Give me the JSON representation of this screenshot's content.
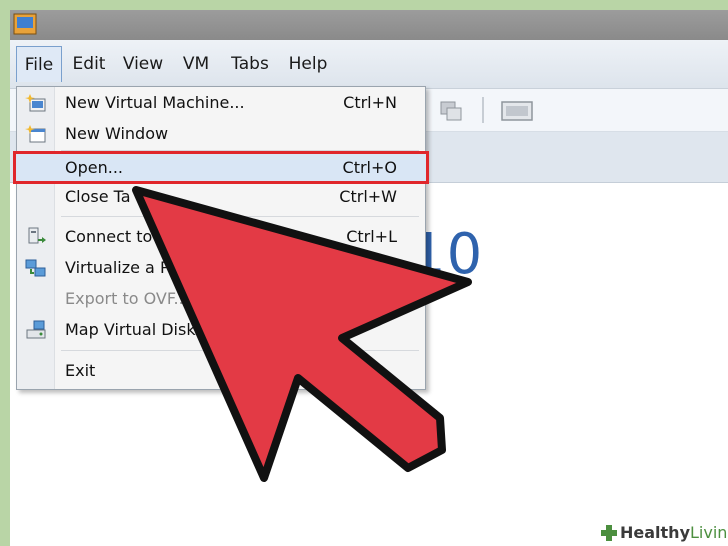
{
  "menubar": {
    "items": [
      {
        "label": "File",
        "active": true
      },
      {
        "label": "Edit"
      },
      {
        "label": "View"
      },
      {
        "label": "VM"
      },
      {
        "label": "Tabs"
      },
      {
        "label": "Help"
      }
    ]
  },
  "content": {
    "number_fragment": "10"
  },
  "file_menu": {
    "items": [
      {
        "label": "New Virtual Machine...",
        "shortcut": "Ctrl+N",
        "icon": "new-vm-icon"
      },
      {
        "label": "New Window",
        "shortcut": "",
        "icon": "new-window-icon"
      },
      {
        "label": "Open...",
        "shortcut": "Ctrl+O",
        "highlighted": true
      },
      {
        "label": "Close Ta",
        "shortcut": "Ctrl+W"
      },
      {
        "label": "Connect to",
        "shortcut": "Ctrl+L",
        "icon": "connect-icon"
      },
      {
        "label": "Virtualize a P",
        "shortcut": "",
        "icon": "virtualize-icon"
      },
      {
        "label": "Export to OVF...",
        "shortcut": "",
        "disabled": true
      },
      {
        "label": "Map Virtual Disks",
        "shortcut": "",
        "icon": "map-disks-icon"
      },
      {
        "label": "Exit",
        "shortcut": ""
      }
    ]
  },
  "watermark": {
    "part1": "Healthy",
    "part2": "Living"
  },
  "colors": {
    "highlight_border": "#e0262b",
    "arrow_fill": "#e33a45",
    "brand_blue": "#2f63ad"
  }
}
